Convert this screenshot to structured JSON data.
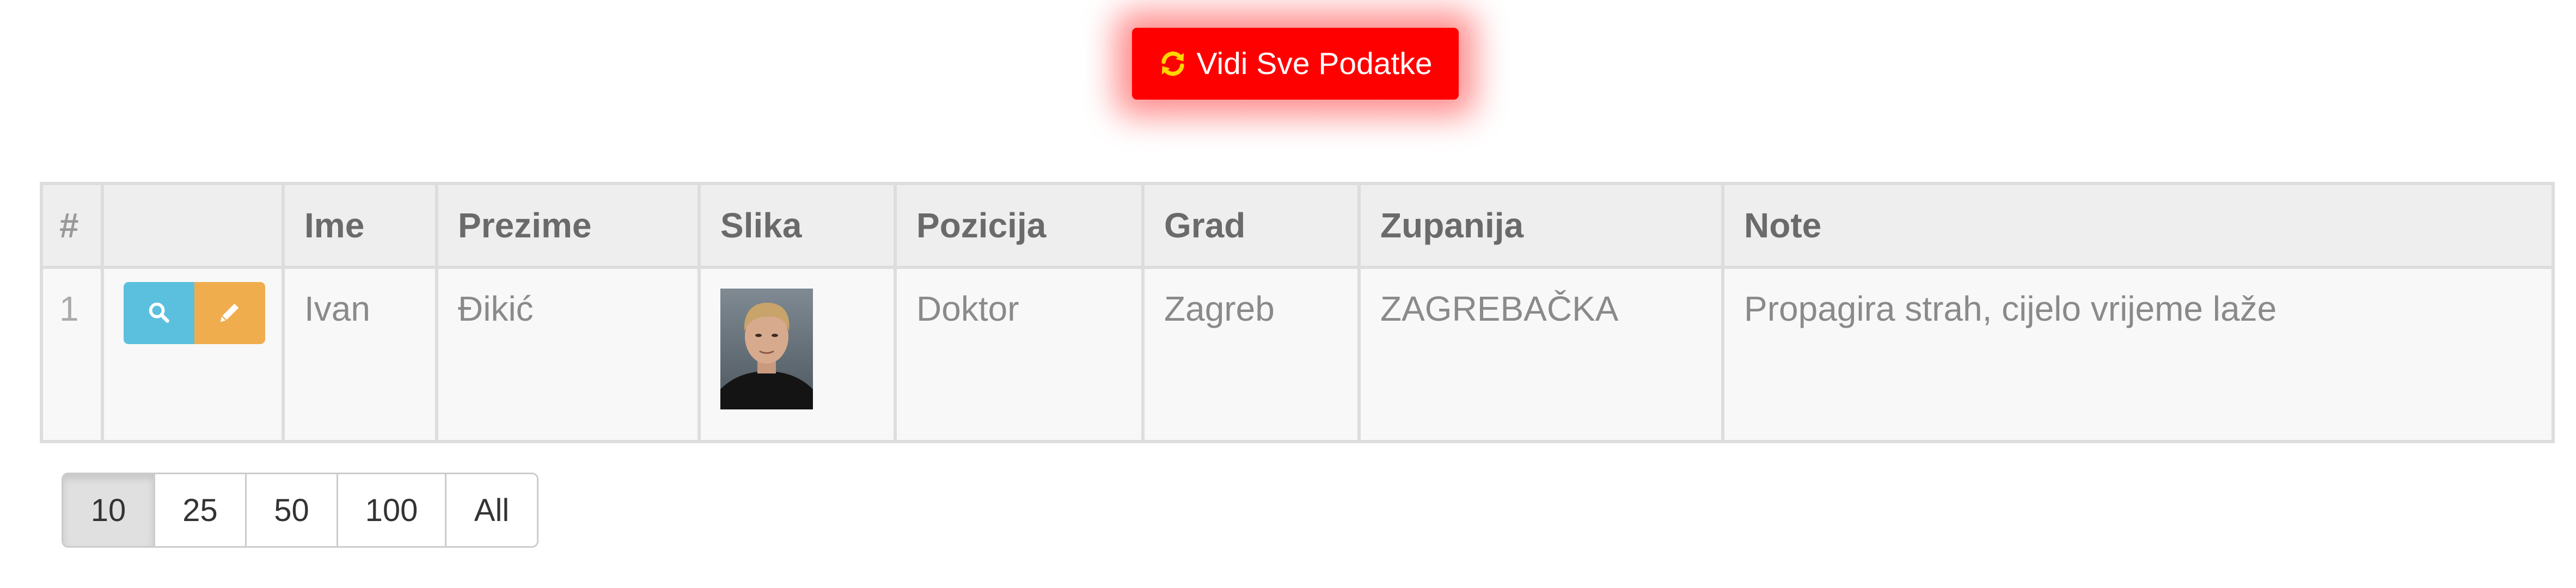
{
  "top_button": {
    "label": "Vidi Sve Podatke",
    "icon": "refresh-icon",
    "background_color": "#ff0000",
    "icon_color": "#ffd500"
  },
  "table": {
    "columns": [
      "#",
      "",
      "Ime",
      "Prezime",
      "Slika",
      "Pozicija",
      "Grad",
      "Zupanija",
      "Note"
    ],
    "rows": [
      {
        "index": "1",
        "actions": [
          {
            "name": "view",
            "icon": "search-icon",
            "color": "#5bc0de"
          },
          {
            "name": "edit",
            "icon": "pencil-icon",
            "color": "#f0ad4e"
          }
        ],
        "ime": "Ivan",
        "prezime": "Đikić",
        "slika": "portrait-photo",
        "pozicija": "Doktor",
        "grad": "Zagreb",
        "zupanija": "ZAGREBAČKA",
        "note": "Propagira strah, cijelo vrijeme laže"
      }
    ]
  },
  "pagination": {
    "options": [
      "10",
      "25",
      "50",
      "100",
      "All"
    ],
    "selected": "10"
  }
}
